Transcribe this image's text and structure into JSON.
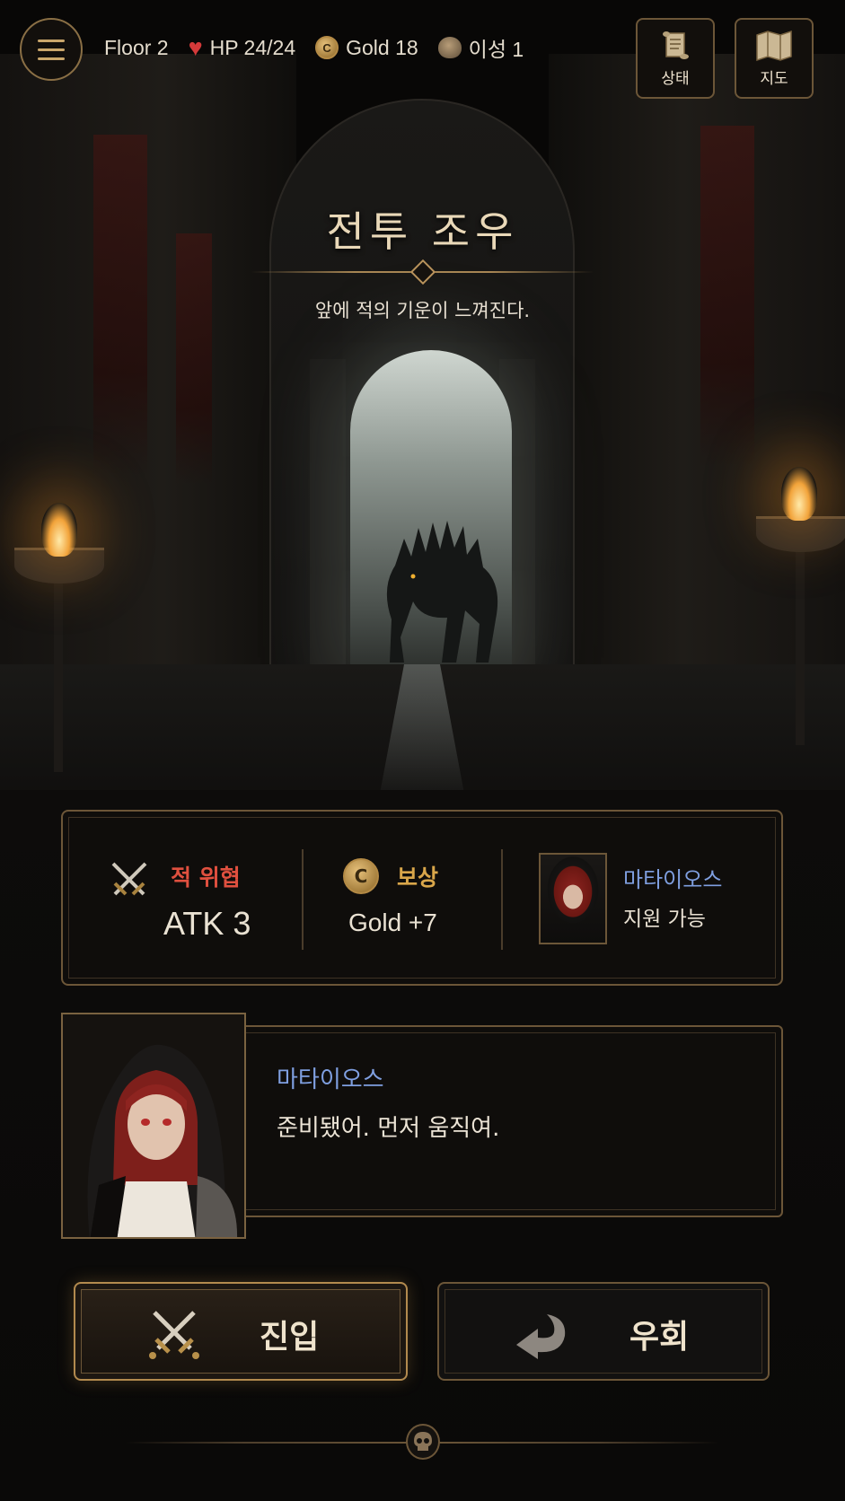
{
  "topbar": {
    "floor": "Floor 2",
    "hp": "HP 24/24",
    "gold": "Gold 18",
    "sanity": "이성 1",
    "status_label": "상태",
    "map_label": "지도"
  },
  "encounter": {
    "title": "전투 조우",
    "subtitle": "앞에 적의 기운이 느껴진다."
  },
  "info": {
    "threat_label": "적 위협",
    "threat_value": "ATK 3",
    "reward_label": "보상",
    "reward_value": "Gold +7",
    "ally_name": "마타이오스",
    "ally_status": "지원 가능"
  },
  "dialogue": {
    "speaker": "마타이오스",
    "line": "준비됐어. 먼저 움직여."
  },
  "actions": {
    "enter_label": "진입",
    "evade_label": "우회"
  },
  "colors": {
    "accent_gold": "#c9a66b",
    "threat_red": "#e0503f",
    "ally_blue": "#7f9fe0"
  },
  "icons": [
    "menu-icon",
    "heart-icon",
    "coin-icon",
    "brain-icon",
    "scroll-icon",
    "map-icon",
    "crossed-swords-icon",
    "return-arrow-icon",
    "skull-icon"
  ]
}
